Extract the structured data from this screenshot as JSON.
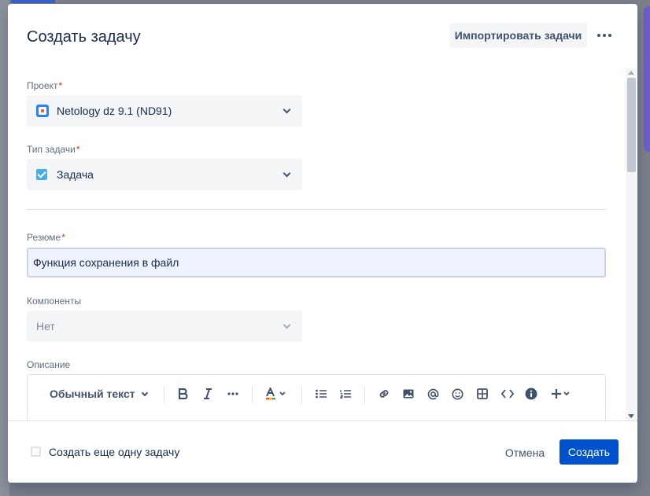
{
  "modal": {
    "title": "Создать задачу",
    "import_label": "Импортировать задачи"
  },
  "form": {
    "project": {
      "label": "Проект",
      "required_mark": "*",
      "value": "Netology dz 9.1 (ND91)"
    },
    "issue_type": {
      "label": "Тип задачи",
      "required_mark": "*",
      "value": "Задача"
    },
    "summary": {
      "label": "Резюме",
      "required_mark": "*",
      "value": "Функция сохранения в файл"
    },
    "components": {
      "label": "Компоненты",
      "value": "Нет"
    },
    "description": {
      "label": "Описание",
      "text_style": "Обычный текст",
      "toolbar_icons": [
        "bold-icon",
        "italic-icon",
        "more-formatting-icon",
        "text-color-icon",
        "bullet-list-icon",
        "numbered-list-icon",
        "link-icon",
        "image-icon",
        "mention-icon",
        "emoji-icon",
        "table-icon",
        "code-icon",
        "info-icon",
        "insert-icon"
      ]
    }
  },
  "footer": {
    "create_another_label": "Создать еще одну задачу",
    "cancel_label": "Отмена",
    "create_label": "Создать"
  },
  "colors": {
    "primary": "#0052cc",
    "required": "#de350b"
  }
}
